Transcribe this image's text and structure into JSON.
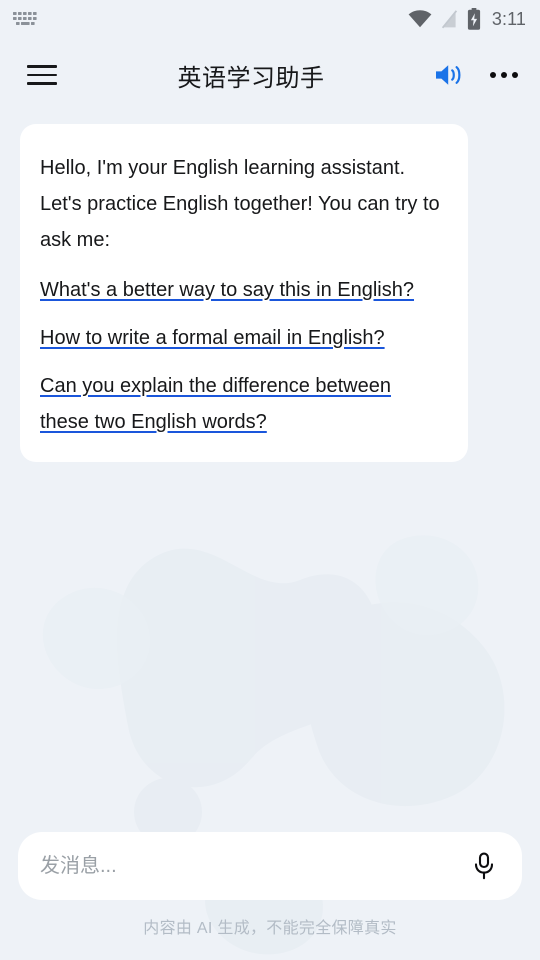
{
  "status_bar": {
    "keyboard_icon": "keyboard-icon",
    "wifi_icon": "wifi-icon",
    "signal_off_icon": "signal-disabled-icon",
    "battery_icon": "battery-charging-icon",
    "time": "3:11"
  },
  "app_bar": {
    "menu_icon": "hamburger-menu-icon",
    "title": "英语学习助手",
    "speaker_icon": "volume-on-icon",
    "more_icon": "more-options-icon"
  },
  "message": {
    "greeting": "Hello, I'm your English learning assistant. Let's practice English together! You can try to ask me:",
    "suggestions": [
      "What's a better way to say this in English?",
      "How to write a formal email in English?",
      "Can you explain the difference between these two English words?"
    ]
  },
  "composer": {
    "placeholder": "发消息...",
    "value": "",
    "mic_icon": "microphone-icon"
  },
  "footer": {
    "disclaimer": "内容由 AI 生成，不能完全保障真实"
  },
  "colors": {
    "background": "#eef2f7",
    "card": "#ffffff",
    "accent_blue": "#1a73e8",
    "link_underline": "#1a56db",
    "text": "#17181a",
    "muted": "#9aa0a6",
    "disclaimer": "#b3bcc6"
  }
}
